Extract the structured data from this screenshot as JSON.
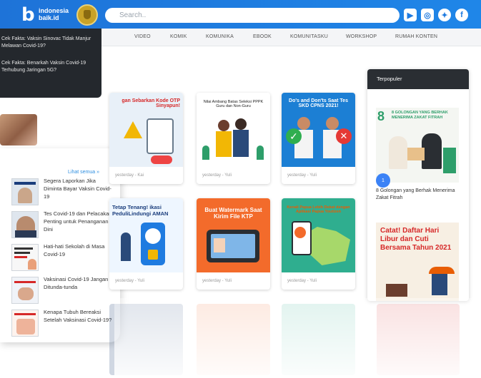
{
  "header": {
    "logo_line1": "indonesia",
    "logo_line2": "baik.id",
    "search_placeholder": "Search..",
    "socials": [
      {
        "icon": "youtube-icon",
        "glyph": "▶"
      },
      {
        "icon": "instagram-icon",
        "glyph": "◎"
      },
      {
        "icon": "twitter-icon",
        "glyph": "✦"
      },
      {
        "icon": "facebook-icon",
        "glyph": "f"
      }
    ]
  },
  "nav": {
    "items": [
      "VIDEO",
      "KOMIK",
      "KOMUNIKA",
      "EBOOK",
      "KOMUNITASKU",
      "WORKSHOP",
      "RUMAH KONTEN"
    ]
  },
  "dropdown": {
    "items": [
      "Cek Fakta: Vaksin Sinovac Tidak Manjur Melawan Covid-19?",
      "Cek Fakta: Benarkah Vaksin Covid-19 Terhubung Jaringan 5G?"
    ]
  },
  "left_panel": {
    "see_all": "Lihat semua »",
    "news": [
      "Segera Laporkan Jika Diminta Bayar Vaksin Covid-19",
      "Tes Covid-19 dan Pelacakan Penting untuk Penanganan Dini",
      "Hati-hati Sekolah di Masa Covid-19",
      "Vaksinasi Covid-19 Jangan Ditunda-tunda",
      "Kenapa Tubuh Bereaksi Setelah Vaksinasi Covid-19?"
    ]
  },
  "cards": [
    {
      "title": "gan Sebarkan Kode OTP Sinyapun!",
      "meta": "yesterday - Kai",
      "bg": "#e8f0f8",
      "accent": "#d62828",
      "title_color": "#d62828"
    },
    {
      "title": "Nilai Ambang Batas Seleksi PPPK Guru dan Non-Guru",
      "meta": "yesterday - Yuli",
      "bg": "#ffffff",
      "accent": "#f2b705",
      "title_color": "#222222"
    },
    {
      "title": "Do's and Don'ts Saat Tes SKD CPNS 2021!",
      "meta": "yesterday - Yuli",
      "bg": "#1c7fd4",
      "accent": "#f7c948",
      "title_color": "#ffffff"
    },
    {
      "title": "Tetap Tenang! ikasi PeduliLindungi AMAN",
      "meta": "yesterday - Yuli",
      "bg": "#eef6ff",
      "accent": "#1f7be0",
      "title_color": "#1a3d7c"
    },
    {
      "title": "Buat Watermark Saat Kirim File KTP",
      "meta": "yesterday - Yuli",
      "bg": "#f36b2b",
      "accent": "#1c7fd4",
      "title_color": "#ffffff"
    },
    {
      "title": "Kenali Papua Lebih Dekat dengan Aplikasi Papua Youtizen",
      "meta": "yesterday - Yuli",
      "bg": "#2fae8f",
      "accent": "#f36b2b",
      "title_color": "#e85d04"
    }
  ],
  "sidebar": {
    "title": "Terpopuler",
    "img1_text": "8 GOLONGAN YANG BERHAK MENERIMA ZAKAT FITRAH",
    "img1_number": "8",
    "rank": "1",
    "caption": "8 Golongan yang Berhak Menerima Zakat Fitrah",
    "img2_text": "Catat! Daftar Hari Libur dan Cuti Bersama Tahun 2021"
  }
}
